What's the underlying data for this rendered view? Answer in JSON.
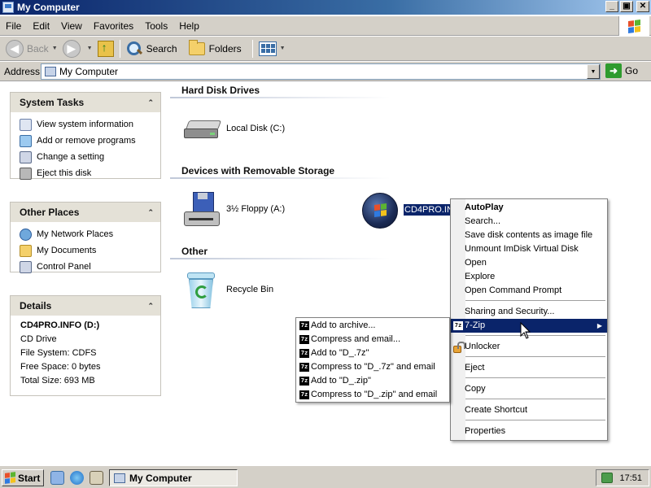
{
  "window": {
    "title": "My Computer"
  },
  "menubar": {
    "items": [
      "File",
      "Edit",
      "View",
      "Favorites",
      "Tools",
      "Help"
    ]
  },
  "toolbar": {
    "back_label": "Back",
    "search_label": "Search",
    "folders_label": "Folders"
  },
  "address": {
    "label": "Address",
    "value": "My Computer",
    "go_label": "Go"
  },
  "system_tasks": {
    "title": "System Tasks",
    "items": [
      "View system information",
      "Add or remove programs",
      "Change a setting",
      "Eject this disk"
    ]
  },
  "other_places": {
    "title": "Other Places",
    "items": [
      "My Network Places",
      "My Documents",
      "Control Panel"
    ]
  },
  "details": {
    "title": "Details",
    "name": "CD4PRO.INFO (D:)",
    "type": "CD Drive",
    "file_system": "File System: CDFS",
    "free_space": "Free Space: 0 bytes",
    "total_size": "Total Size: 693 MB"
  },
  "groups": {
    "hard_disks": "Hard Disk Drives",
    "removable": "Devices with Removable Storage",
    "other": "Other"
  },
  "items": {
    "local_disk": "Local Disk (C:)",
    "floppy": "3½ Floppy (A:)",
    "cd_drive": "CD4PRO.IN",
    "recycle_bin": "Recycle Bin"
  },
  "context_menu": {
    "autoplay": "AutoPlay",
    "search": "Search...",
    "save_image": "Save disk contents as image file",
    "unmount": "Unmount ImDisk Virtual Disk",
    "open": "Open",
    "explore": "Explore",
    "open_cmd": "Open Command Prompt",
    "sharing": "Sharing and Security...",
    "sevenzip": "7-Zip",
    "unlocker": "Unlocker",
    "eject": "Eject",
    "copy": "Copy",
    "create_shortcut": "Create Shortcut",
    "properties": "Properties"
  },
  "sevenzip_menu": {
    "icon_text": "7z",
    "items": [
      "Add to archive...",
      "Compress and email...",
      "Add to \"D_.7z\"",
      "Compress to \"D_.7z\" and email",
      "Add to \"D_.zip\"",
      "Compress to \"D_.zip\" and email"
    ]
  },
  "taskbar": {
    "start_label": "Start",
    "task_label": "My Computer",
    "clock": "17:51"
  },
  "colors": {
    "accent": "#0a246a",
    "face": "#d4d0c8",
    "panel_head": "#e4e1d7"
  }
}
